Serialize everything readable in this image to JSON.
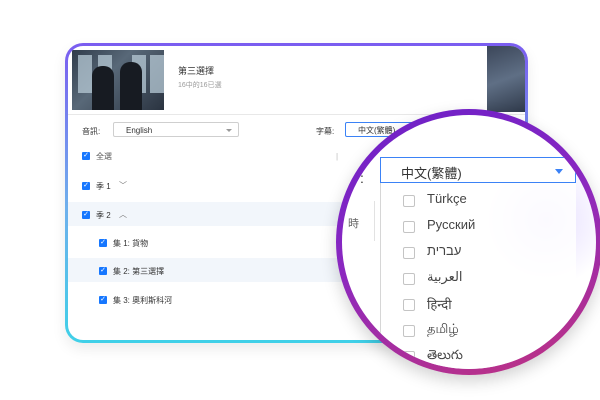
{
  "episode": {
    "title": "第三選擇",
    "subtitle": "16中的16已選"
  },
  "audio": {
    "label": "音訊:",
    "value": "English"
  },
  "subtitle_select": {
    "label": "字幕:",
    "value": "中文(繁體)"
  },
  "tree": {
    "select_all": "全選",
    "season1": "季 1",
    "season2": "季 2",
    "episodes": [
      "集 1: 貨物",
      "集 2: 第三選擇",
      "集 3: 奧利斯科河"
    ]
  },
  "magnifier": {
    "colon": ":",
    "selected": "中文(繁體)",
    "fragment": "時",
    "options": [
      "Türkçe",
      "Русский",
      "עברית",
      "العربية",
      "हिन्दी",
      "தமிழ்",
      "తెలుగు"
    ]
  },
  "colors": {
    "accent": "#1677ff",
    "ring_top": "#6a1fc9",
    "ring_bottom": "#c2337d"
  }
}
